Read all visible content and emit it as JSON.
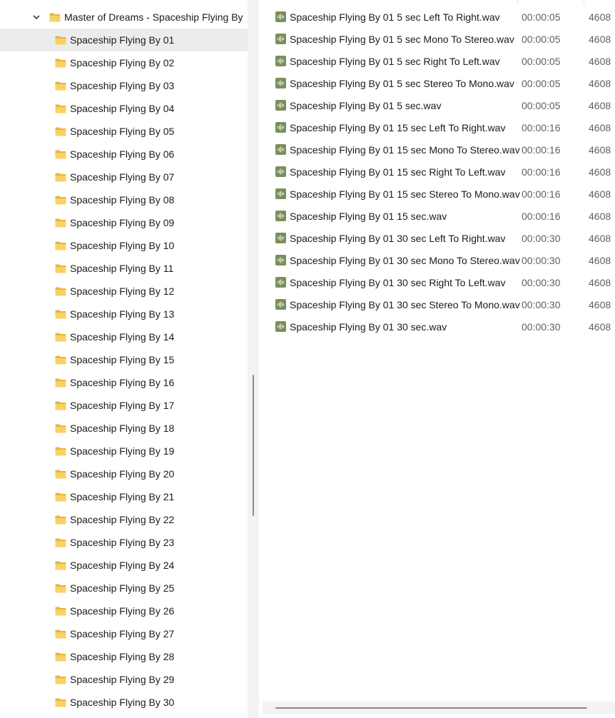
{
  "icons": {
    "folder": "folder-icon",
    "audio": "audio-file-icon",
    "expand": "chevron-down-icon"
  },
  "colors": {
    "folder": "#f4c84c",
    "audio_icon": "#7b8f5b",
    "selected_row": "#ececec"
  },
  "tree": {
    "parent_label": "Master of Dreams - Spaceship Flying By",
    "items": [
      "Spaceship Flying By 01",
      "Spaceship Flying By 02",
      "Spaceship Flying By 03",
      "Spaceship Flying By 04",
      "Spaceship Flying By 05",
      "Spaceship Flying By 06",
      "Spaceship Flying By 07",
      "Spaceship Flying By 08",
      "Spaceship Flying By 09",
      "Spaceship Flying By 10",
      "Spaceship Flying By 11",
      "Spaceship Flying By 12",
      "Spaceship Flying By 13",
      "Spaceship Flying By 14",
      "Spaceship Flying By 15",
      "Spaceship Flying By 16",
      "Spaceship Flying By 17",
      "Spaceship Flying By 18",
      "Spaceship Flying By 19",
      "Spaceship Flying By 20",
      "Spaceship Flying By 21",
      "Spaceship Flying By 22",
      "Spaceship Flying By 23",
      "Spaceship Flying By 24",
      "Spaceship Flying By 25",
      "Spaceship Flying By 26",
      "Spaceship Flying By 27",
      "Spaceship Flying By 28",
      "Spaceship Flying By 29",
      "Spaceship Flying By 30"
    ],
    "selected_index": 0
  },
  "files": [
    {
      "name": "Spaceship Flying By 01 5 sec Left To Right.wav",
      "duration": "00:00:05",
      "size": "4608"
    },
    {
      "name": "Spaceship Flying By 01 5 sec Mono To Stereo.wav",
      "duration": "00:00:05",
      "size": "4608"
    },
    {
      "name": "Spaceship Flying By 01 5 sec Right To Left.wav",
      "duration": "00:00:05",
      "size": "4608"
    },
    {
      "name": "Spaceship Flying By 01 5 sec Stereo To Mono.wav",
      "duration": "00:00:05",
      "size": "4608"
    },
    {
      "name": "Spaceship Flying By 01 5 sec.wav",
      "duration": "00:00:05",
      "size": "4608"
    },
    {
      "name": "Spaceship Flying By 01 15 sec Left To Right.wav",
      "duration": "00:00:16",
      "size": "4608"
    },
    {
      "name": "Spaceship Flying By 01 15 sec Mono To Stereo.wav",
      "duration": "00:00:16",
      "size": "4608"
    },
    {
      "name": "Spaceship Flying By 01 15 sec Right To Left.wav",
      "duration": "00:00:16",
      "size": "4608"
    },
    {
      "name": "Spaceship Flying By 01 15 sec Stereo To Mono.wav",
      "duration": "00:00:16",
      "size": "4608"
    },
    {
      "name": "Spaceship Flying By 01 15 sec.wav",
      "duration": "00:00:16",
      "size": "4608"
    },
    {
      "name": "Spaceship Flying By 01 30 sec Left To Right.wav",
      "duration": "00:00:30",
      "size": "4608"
    },
    {
      "name": "Spaceship Flying By 01 30 sec Mono To Stereo.wav",
      "duration": "00:00:30",
      "size": "4608"
    },
    {
      "name": "Spaceship Flying By 01 30 sec Right To Left.wav",
      "duration": "00:00:30",
      "size": "4608"
    },
    {
      "name": "Spaceship Flying By 01 30 sec Stereo To Mono.wav",
      "duration": "00:00:30",
      "size": "4608"
    },
    {
      "name": "Spaceship Flying By 01 30 sec.wav",
      "duration": "00:00:30",
      "size": "4608"
    }
  ]
}
